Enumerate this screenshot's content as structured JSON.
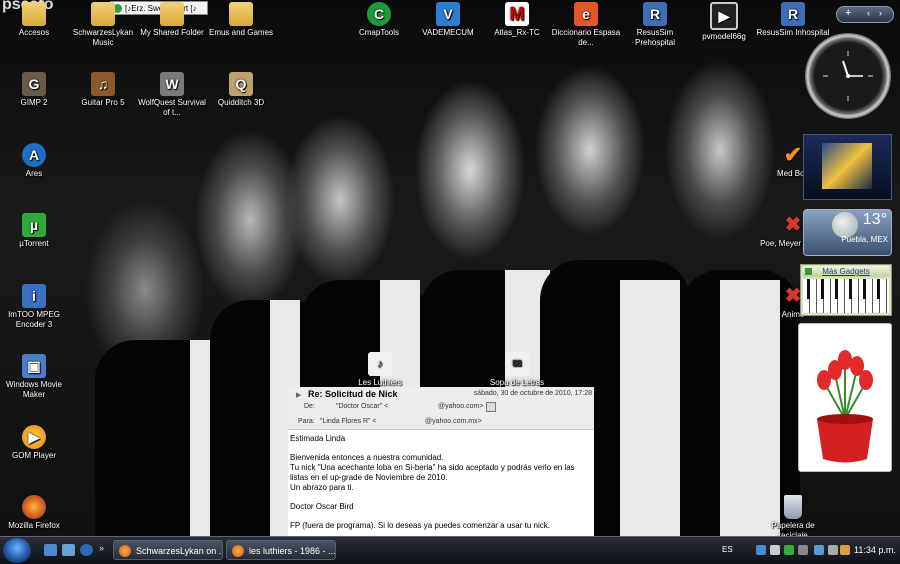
{
  "top_tooltip": {
    "site": "pseafo",
    "label": "[♪Erz. Sweetheart [♪"
  },
  "desktop_icons": [
    {
      "label": "Accesos",
      "icon": "folder-icon"
    },
    {
      "label": "SchwarzesLykan Music",
      "icon": "folder-icon"
    },
    {
      "label": "My Shared Folder",
      "icon": "folder-icon"
    },
    {
      "label": "Emus and Games",
      "icon": "folder-icon"
    },
    {
      "label": "CmapTools",
      "icon": "cmaptools-icon"
    },
    {
      "label": "VADEMECUM",
      "icon": "vademecum-icon"
    },
    {
      "label": "Atlas_Rx-TC",
      "icon": "atlas-icon"
    },
    {
      "label": "Diccionario Espasa de...",
      "icon": "dictionary-icon"
    },
    {
      "label": "ResusSim Prehospital",
      "icon": "resussim-icon"
    },
    {
      "label": "pvmodel66g",
      "icon": "film-icon"
    },
    {
      "label": "ResusSim Inhospital",
      "icon": "resussim-icon"
    },
    {
      "label": "GIMP 2",
      "icon": "gimp-icon"
    },
    {
      "label": "Guitar Pro 5",
      "icon": "guitar-pro-icon"
    },
    {
      "label": "WolfQuest Survival of t...",
      "icon": "wolfquest-icon"
    },
    {
      "label": "Quidditch 3D",
      "icon": "quidditch-icon"
    },
    {
      "label": "Ares",
      "icon": "ares-icon"
    },
    {
      "label": "µTorrent",
      "icon": "utorrent-icon"
    },
    {
      "label": "ImTOO MPEG Encoder 3",
      "icon": "imtoo-icon"
    },
    {
      "label": "Windows Movie Maker",
      "icon": "movie-maker-icon"
    },
    {
      "label": "GOM Player",
      "icon": "gom-player-icon"
    },
    {
      "label": "Mozilla Firefox",
      "icon": "firefox-icon"
    },
    {
      "label": "Les Luthiers",
      "icon": "document-icon"
    },
    {
      "label": "Sopa de Letras",
      "icon": "document-icon"
    },
    {
      "label": "Med Boo",
      "icon": "checkmark-icon"
    },
    {
      "label": "Poe, Meyer King...",
      "icon": "document-icon"
    },
    {
      "label": "Anime",
      "icon": "document-icon"
    },
    {
      "label": "Papelera de reciclaje",
      "icon": "recycle-bin-icon"
    }
  ],
  "sidebar": {
    "add_symbol": "+"
  },
  "weather": {
    "temp": "13°",
    "location": "Puebla, MEX"
  },
  "gadgets_link": "Más Gadgets",
  "email": {
    "subject": "Re: Solicitud de Nick",
    "date": "sábado, 30 de octubre de 2010, 17:28",
    "from_label": "De:",
    "from_name": "\"Doctor Oscar\" <",
    "from_domain": "@yahoo.com>",
    "to_label": "Para:",
    "to_name": "\"Linda Flores R\" <",
    "to_domain": "@yahoo.com.mx>",
    "greeting": "Estimada Linda",
    "p1_line1": "Bienvenida entonces a nuestra comunidad.",
    "p1_line2": "Tu nick \"Una acechante loba en Si-beria\" ha sido aceptado y podrás verlo en las",
    "p1_line3": "listas en el up-grade de Noviembre de 2010.",
    "p1_line4": "Un abrazo para ti.",
    "signature": "Doctor Oscar Bird",
    "footer": "FP (fuera de programa). Si lo deseas ya puedes comenzar a usar tu nick."
  },
  "taskbar": {
    "tasks": [
      {
        "label": "SchwarzesLykan on ..."
      },
      {
        "label": "les luthiers - 1986 - ..."
      }
    ],
    "lang": "ES",
    "clock": "11:34 p.m."
  }
}
